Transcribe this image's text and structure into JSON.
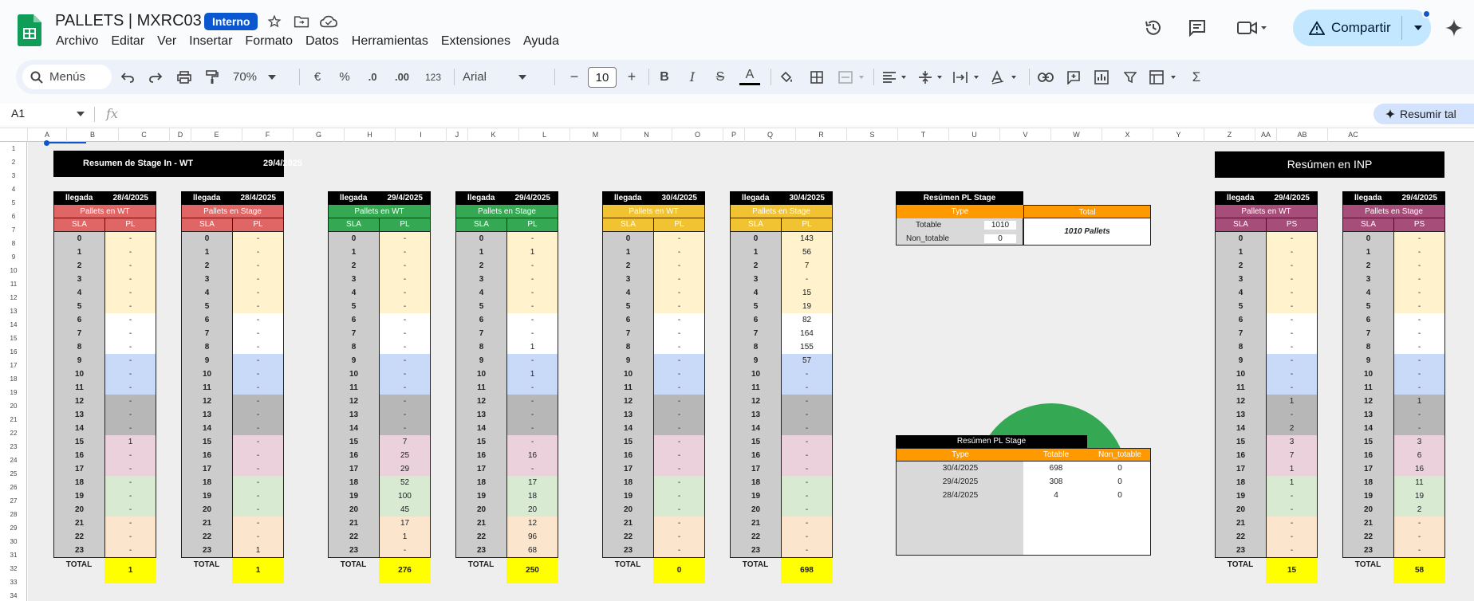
{
  "app": {
    "title": "PALLETS | MXRC03",
    "badge": "Interno",
    "menu": [
      "Archivo",
      "Editar",
      "Ver",
      "Insertar",
      "Formato",
      "Datos",
      "Herramientas",
      "Extensiones",
      "Ayuda"
    ],
    "share_label": "Compartir"
  },
  "toolbar": {
    "search_label": "Menús",
    "zoom": "70%",
    "currency": "€",
    "percent": "%",
    "dec_minus": ".0",
    "dec_plus": ".00",
    "number_format": "123",
    "font": "Arial",
    "font_size": "10",
    "bold": "B",
    "italic": "I",
    "strike": "S",
    "text_color": "A",
    "sum": "Σ"
  },
  "formula_bar": {
    "cell_ref": "A1",
    "fx": "fx",
    "summarize_label": "Resumir tal"
  },
  "columns": [
    "A",
    "B",
    "C",
    "D",
    "E",
    "F",
    "G",
    "H",
    "I",
    "J",
    "K",
    "L",
    "M",
    "N",
    "O",
    "P",
    "Q",
    "R",
    "S",
    "T",
    "U",
    "V",
    "W",
    "X",
    "Y",
    "Z",
    "AA",
    "AB",
    "AC"
  ],
  "rows": [
    "1",
    "2",
    "3",
    "4",
    "5",
    "6",
    "7",
    "8",
    "9",
    "10",
    "11",
    "12",
    "13",
    "14",
    "15",
    "16",
    "17",
    "18",
    "19",
    "20",
    "21",
    "22",
    "23",
    "24",
    "25",
    "26",
    "27",
    "28",
    "29",
    "30",
    "31",
    "32",
    "33",
    "34"
  ],
  "banner_left": {
    "title": "Resumen de Stage In - WT",
    "date": "29/4/2025"
  },
  "banner_right": {
    "title": "Resúmen en INP"
  },
  "sla_values": [
    "0",
    "1",
    "2",
    "3",
    "4",
    "5",
    "6",
    "7",
    "8",
    "9",
    "10",
    "11",
    "12",
    "13",
    "14",
    "15",
    "16",
    "17",
    "18",
    "19",
    "20",
    "21",
    "22",
    "23"
  ],
  "tables": [
    {
      "llegada": "llegada",
      "date": "28/4/2025",
      "band": "Pallets en WT",
      "band_color": "#e06666",
      "col1": "SLA",
      "col2": "PL",
      "total_label": "TOTAL",
      "total": "1",
      "values": [
        "-",
        "-",
        "-",
        "-",
        "-",
        "-",
        "-",
        "-",
        "-",
        "-",
        "-",
        "-",
        "-",
        "-",
        "-",
        "1",
        "-",
        "-",
        "-",
        "-",
        "-",
        "-",
        "-",
        "-"
      ]
    },
    {
      "llegada": "llegada",
      "date": "28/4/2025",
      "band": "Pallets en Stage",
      "band_color": "#e06666",
      "col1": "SLA",
      "col2": "PL",
      "total_label": "TOTAL",
      "total": "1",
      "values": [
        "-",
        "-",
        "-",
        "-",
        "-",
        "-",
        "-",
        "-",
        "-",
        "-",
        "-",
        "-",
        "-",
        "-",
        "-",
        "-",
        "-",
        "-",
        "-",
        "-",
        "-",
        "-",
        "-",
        "1"
      ]
    },
    {
      "llegada": "llegada",
      "date": "29/4/2025",
      "band": "Pallets en WT",
      "band_color": "#34a853",
      "col1": "SLA",
      "col2": "PL",
      "total_label": "TOTAL",
      "total": "276",
      "values": [
        "-",
        "-",
        "-",
        "-",
        "-",
        "-",
        "-",
        "-",
        "-",
        "-",
        "-",
        "-",
        "-",
        "-",
        "-",
        "7",
        "25",
        "29",
        "52",
        "100",
        "45",
        "17",
        "1",
        "-"
      ]
    },
    {
      "llegada": "llegada",
      "date": "29/4/2025",
      "band": "Pallets en Stage",
      "band_color": "#34a853",
      "col1": "SLA",
      "col2": "PL",
      "total_label": "TOTAL",
      "total": "250",
      "values": [
        "-",
        "1",
        "-",
        "-",
        "-",
        "-",
        "-",
        "-",
        "1",
        "-",
        "1",
        "-",
        "-",
        "-",
        "-",
        "-",
        "16",
        "-",
        "17",
        "18",
        "20",
        "12",
        "96",
        "68"
      ]
    },
    {
      "llegada": "llegada",
      "date": "30/4/2025",
      "band": "Pallets en WT",
      "band_color": "#f1c232",
      "col1": "SLA",
      "col2": "PL",
      "total_label": "TOTAL",
      "total": "0",
      "values": [
        "-",
        "-",
        "-",
        "-",
        "-",
        "-",
        "-",
        "-",
        "-",
        "-",
        "-",
        "-",
        "-",
        "-",
        "-",
        "-",
        "-",
        "-",
        "-",
        "-",
        "-",
        "-",
        "-",
        "-"
      ]
    },
    {
      "llegada": "llegada",
      "date": "30/4/2025",
      "band": "Pallets en Stage",
      "band_color": "#f1c232",
      "col1": "SLA",
      "col2": "PL",
      "total_label": "TOTAL",
      "total": "698",
      "values": [
        "143",
        "56",
        "7",
        "-",
        "15",
        "19",
        "82",
        "164",
        "155",
        "57",
        "-",
        "-",
        "-",
        "-",
        "-",
        "-",
        "-",
        "-",
        "-",
        "-",
        "-",
        "-",
        "-",
        "-"
      ]
    },
    {
      "llegada": "llegada",
      "date": "29/4/2025",
      "band": "Pallets en WT",
      "band_color": "#a64d79",
      "col1": "SLA",
      "col2": "PS",
      "total_label": "TOTAL",
      "total": "15",
      "values": [
        "-",
        "-",
        "-",
        "-",
        "-",
        "-",
        "-",
        "-",
        "-",
        "-",
        "-",
        "-",
        "1",
        "-",
        "2",
        "3",
        "7",
        "1",
        "1",
        "-",
        "-",
        "-",
        "-",
        "-"
      ]
    },
    {
      "llegada": "llegada",
      "date": "29/4/2025",
      "band": "Pallets en Stage",
      "band_color": "#a64d79",
      "col1": "SLA",
      "col2": "PS",
      "total_label": "TOTAL",
      "total": "58",
      "values": [
        "-",
        "-",
        "-",
        "-",
        "-",
        "-",
        "-",
        "-",
        "-",
        "-",
        "-",
        "-",
        "1",
        "-",
        "-",
        "3",
        "6",
        "16",
        "11",
        "19",
        "2",
        "-",
        "-",
        "-"
      ]
    }
  ],
  "summary1": {
    "title": "Resúmen PL Stage",
    "col_type": "Type",
    "col_total": "Total",
    "rows": [
      {
        "type": "Totable",
        "value": "1010"
      },
      {
        "type": "Non_totable",
        "value": "0"
      }
    ],
    "total_text": "1010 Pallets",
    "header_color": "#ff9900"
  },
  "donut": {
    "totable": 1010,
    "non_totable": 0,
    "color": "#34a853"
  },
  "summary2": {
    "title": "Resúmen PL Stage",
    "headers": [
      "Type",
      "Totable",
      "Non_totable"
    ],
    "rows": [
      {
        "type": "30/4/2025",
        "totable": "698",
        "non": "0"
      },
      {
        "type": "29/4/2025",
        "totable": "308",
        "non": "0"
      },
      {
        "type": "28/4/2025",
        "totable": "4",
        "non": "0"
      }
    ]
  }
}
